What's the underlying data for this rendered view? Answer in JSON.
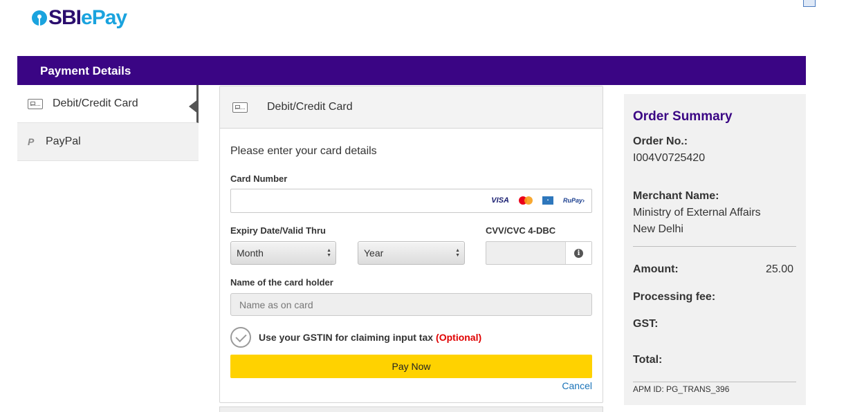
{
  "brand": {
    "logo_sbi": "SBI",
    "logo_epay": "ePay",
    "primary_color": "#3a0584",
    "accent_color": "#1aa3de"
  },
  "header": {
    "title": "Payment Details"
  },
  "nav": {
    "items": [
      {
        "label": "Debit/Credit Card",
        "icon": "card-icon",
        "active": true
      },
      {
        "label": "PayPal",
        "icon": "paypal-icon",
        "active": false
      }
    ]
  },
  "form": {
    "panel_title": "Debit/Credit Card",
    "intro": "Please enter your card details",
    "card_number_label": "Card Number",
    "card_brands": [
      "VISA",
      "Mastercard",
      "AMEX",
      "RuPay"
    ],
    "visa_label": "VISA",
    "rupay_label": "RuPay›",
    "expiry_label": "Expiry Date/Valid Thru",
    "month_value": "Month",
    "year_value": "Year",
    "cvv_label": "CVV/CVC 4-DBC",
    "cardholder_label": "Name of the card holder",
    "cardholder_placeholder": "Name as on card",
    "gst_text": "Use your GSTIN for claiming input tax",
    "gst_optional": "(Optional)",
    "pay_button": "Pay Now",
    "cancel_link": "Cancel",
    "pay_button_color": "#ffd200",
    "optional_color": "#e00000"
  },
  "summary": {
    "title": "Order Summary",
    "order_no_label": "Order No.:",
    "order_no_value": "I004V0725420",
    "merchant_label": "Merchant Name:",
    "merchant_line1": "Ministry of External Affairs",
    "merchant_line2": "New Delhi",
    "amount_label": "Amount:",
    "amount_value": "25.00",
    "processing_fee_label": "Processing fee:",
    "gst_label": "GST:",
    "total_label": "Total:",
    "apm_id": "APM ID: PG_TRANS_396"
  }
}
